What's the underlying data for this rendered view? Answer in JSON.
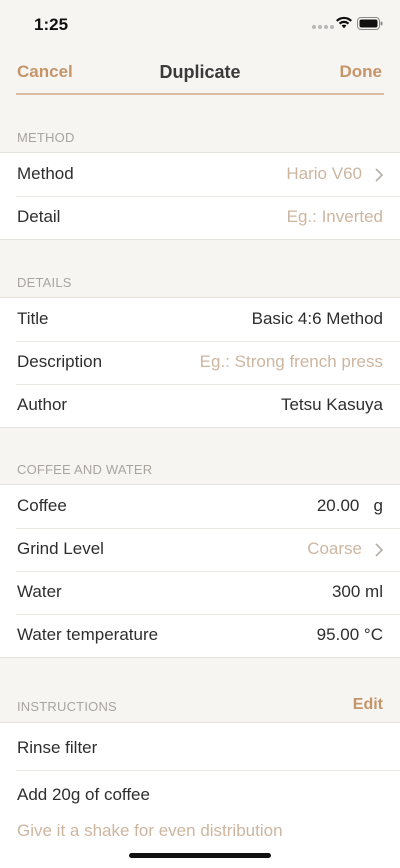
{
  "status": {
    "time": "1:25"
  },
  "nav": {
    "cancel_label": "Cancel",
    "title": "Duplicate",
    "done_label": "Done"
  },
  "sections": {
    "method": {
      "header": "METHOD",
      "rows": [
        {
          "label": "Method",
          "value": "Hario V60"
        },
        {
          "label": "Detail",
          "placeholder": "Eg.: Inverted"
        }
      ]
    },
    "details": {
      "header": "DETAILS",
      "rows": [
        {
          "label": "Title",
          "value": "Basic 4:6 Method"
        },
        {
          "label": "Description",
          "placeholder": "Eg.: Strong french press"
        },
        {
          "label": "Author",
          "value": "Tetsu Kasuya"
        }
      ]
    },
    "coffee_water": {
      "header": "COFFEE AND WATER",
      "rows": [
        {
          "label": "Coffee",
          "value": "20.00",
          "unit": "g"
        },
        {
          "label": "Grind Level",
          "value": "Coarse"
        },
        {
          "label": "Water",
          "value": "300",
          "unit": "ml"
        },
        {
          "label": "Water temperature",
          "value": "95.00",
          "unit": "°C"
        }
      ]
    },
    "instructions": {
      "header": "INSTRUCTIONS",
      "edit_label": "Edit",
      "items": [
        {
          "title": "Rinse filter"
        },
        {
          "title": "Add 20g of coffee",
          "subtitle": "Give it a shake for even distribution"
        }
      ]
    }
  },
  "colors": {
    "accent": "#c4956a",
    "placeholder": "#cdb6a0",
    "background": "#f7f5f2"
  }
}
